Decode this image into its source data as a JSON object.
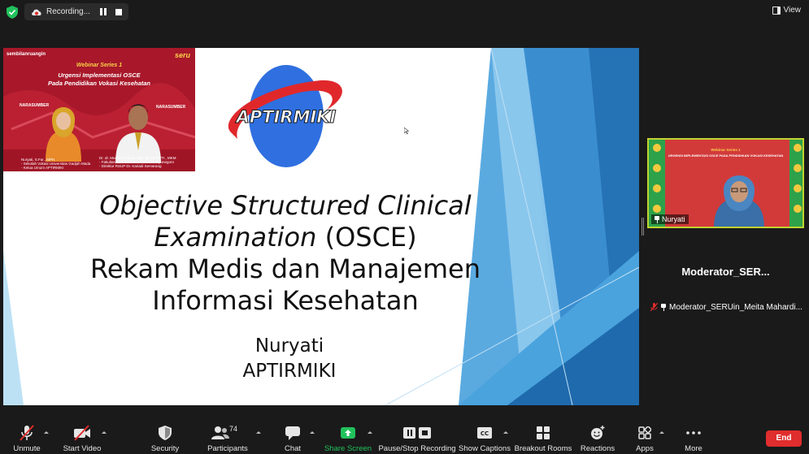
{
  "topbar": {
    "recording_label": "Recording...",
    "view_label": "View"
  },
  "slide": {
    "banner": {
      "brand": "sembilanruangin",
      "logo": "seru",
      "series": "Webinar Series 1",
      "title_line1": "Urgensi Implementasi OSCE",
      "title_line2": "Pada Pendidikan Vokasi Kesehatan",
      "speaker_tag1": "NARASUMBER",
      "speaker_tag2": "NARASUMBER",
      "speaker1_caption": [
        "Nuryati, S.Far., MPH",
        "- Sekolah Vokasi Universitas Gadjah Mada",
        "- Ketua Umum APTIRMIKI"
      ],
      "speaker2_caption": [
        "Dr. dr. Muchlis Achsan Udji, Sp.PD.KPTI., MKM",
        "- Fakultas Kedokteran Universitas Diponegoro",
        "- Direktur RSUP Dr. Kariadi Semarang"
      ]
    },
    "logo_text": "APTIRMIKI",
    "title_italic_1": "Objective Structured Clinical",
    "title_italic_2": "Examination",
    "title_plain_2": " (OSCE)",
    "title_line3": "Rekam Medis dan Manajemen",
    "title_line4": "Informasi Kesehatan",
    "presenter_name": "Nuryati",
    "presenter_org": "APTIRMIKI"
  },
  "participants_panel": {
    "video_tile": {
      "header": "Webinar Series 1",
      "subheader": "URGENSI IMPLEMENTASI OSCE PADA PENDIDIKAN VOKASI KESEHATAN",
      "name": "Nuryati"
    },
    "moderator_tile": {
      "display_name": "Moderator_SER...",
      "full_name": "Moderator_SERUin_Meita Mahardi..."
    }
  },
  "toolbar": {
    "unmute": "Unmute",
    "start_video": "Start Video",
    "security": "Security",
    "participants": "Participants",
    "participant_count": "74",
    "chat": "Chat",
    "share_screen": "Share Screen",
    "pause_recording": "Pause/Stop Recording",
    "show_captions": "Show Captions",
    "breakout_rooms": "Breakout Rooms",
    "reactions": "Reactions",
    "apps": "Apps",
    "more": "More",
    "end": "End"
  },
  "colors": {
    "share_green": "#21c15c",
    "end_red": "#e02d2d",
    "slide_blue": "#3d8fd1",
    "logo_blue": "#2f6fe0",
    "logo_red": "#e0282b"
  }
}
